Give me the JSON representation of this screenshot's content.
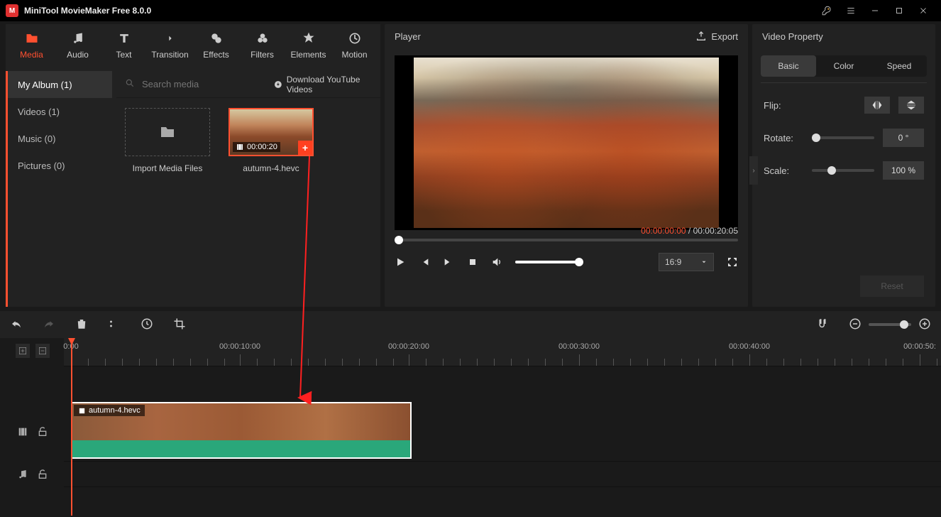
{
  "app": {
    "title": "MiniTool MovieMaker Free 8.0.0"
  },
  "tabs": {
    "media": "Media",
    "audio": "Audio",
    "text": "Text",
    "transition": "Transition",
    "effects": "Effects",
    "filters": "Filters",
    "elements": "Elements",
    "motion": "Motion"
  },
  "sidebar": {
    "my_album": {
      "label": "My Album (1)"
    },
    "videos": {
      "label": "Videos (1)"
    },
    "music": {
      "label": "Music (0)"
    },
    "pictures": {
      "label": "Pictures (0)"
    }
  },
  "media": {
    "search_placeholder": "Search media",
    "download_yt": "Download YouTube Videos",
    "import_label": "Import Media Files",
    "clip1": {
      "name": "autumn-4.hevc",
      "duration": "00:00:20"
    }
  },
  "player": {
    "title": "Player",
    "export": "Export",
    "current": "00:00:00:00",
    "total": "00:00:20:05",
    "ratio": "16:9"
  },
  "property": {
    "title": "Video Property",
    "tabs": {
      "basic": "Basic",
      "color": "Color",
      "speed": "Speed"
    },
    "flip": "Flip:",
    "rotate": "Rotate:",
    "rotate_val": "0 °",
    "scale": "Scale:",
    "scale_val": "100 %",
    "reset": "Reset"
  },
  "timeline": {
    "ticks": [
      "0:00",
      "00:00:10:00",
      "00:00:20:00",
      "00:00:30:00",
      "00:00:40:00",
      "00:00:50:"
    ],
    "clip_name": "autumn-4.hevc"
  }
}
